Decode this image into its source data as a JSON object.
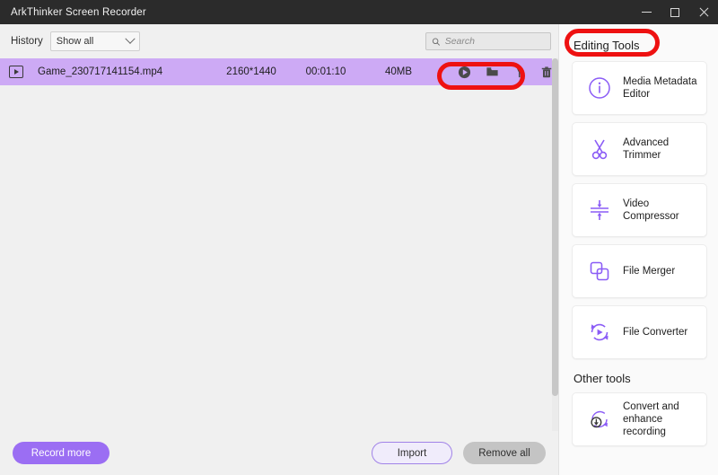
{
  "window": {
    "title": "ArkThinker Screen Recorder",
    "controls": [
      {
        "name": "minimize",
        "glyph": "minimize-icon"
      },
      {
        "name": "maximize",
        "glyph": "maximize-icon"
      },
      {
        "name": "close",
        "glyph": "close-icon"
      }
    ]
  },
  "toolbar": {
    "history_label": "History",
    "history_value": "Show all",
    "search_placeholder": "Search",
    "search_value": ""
  },
  "file_list": {
    "rows": [
      {
        "name": "Game_230717141154.mp4",
        "resolution": "2160*1440",
        "duration": "00:01:10",
        "size": "40MB",
        "actions": [
          "play-icon",
          "folder-icon",
          "wrench-icon",
          "trash-icon"
        ]
      }
    ]
  },
  "bottom_bar": {
    "record_more": "Record more",
    "import": "Import",
    "remove_all": "Remove all"
  },
  "side_panel": {
    "editing_tools_heading": "Editing Tools",
    "other_tools_heading": "Other tools",
    "editing_tools": [
      {
        "label": "Media Metadata Editor",
        "icon": "info-circle-icon"
      },
      {
        "label": "Advanced Trimmer",
        "icon": "scissors-icon"
      },
      {
        "label": "Video Compressor",
        "icon": "compress-icon"
      },
      {
        "label": "File Merger",
        "icon": "merge-squares-icon"
      },
      {
        "label": "File Converter",
        "icon": "convert-play-icon"
      }
    ],
    "other_tools": [
      {
        "label": "Convert and enhance recording",
        "icon": "download-refresh-icon"
      }
    ]
  },
  "colors": {
    "accent_purple": "#9b6ef3",
    "row_highlight": "#cdaaf5",
    "annotation_red": "#ee1111",
    "titlebar": "#2b2b2b"
  }
}
